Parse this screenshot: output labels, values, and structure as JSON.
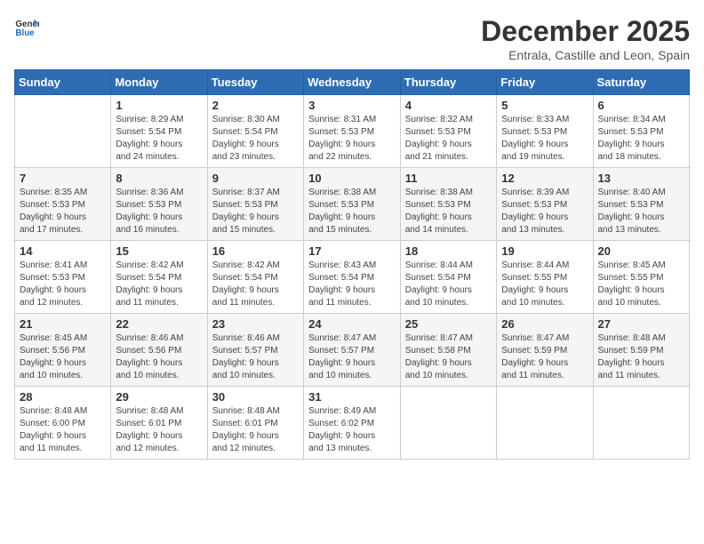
{
  "logo": {
    "general": "General",
    "blue": "Blue"
  },
  "title": "December 2025",
  "subtitle": "Entrala, Castille and Leon, Spain",
  "weekdays": [
    "Sunday",
    "Monday",
    "Tuesday",
    "Wednesday",
    "Thursday",
    "Friday",
    "Saturday"
  ],
  "weeks": [
    [
      {
        "day": "",
        "info": ""
      },
      {
        "day": "1",
        "info": "Sunrise: 8:29 AM\nSunset: 5:54 PM\nDaylight: 9 hours\nand 24 minutes."
      },
      {
        "day": "2",
        "info": "Sunrise: 8:30 AM\nSunset: 5:54 PM\nDaylight: 9 hours\nand 23 minutes."
      },
      {
        "day": "3",
        "info": "Sunrise: 8:31 AM\nSunset: 5:53 PM\nDaylight: 9 hours\nand 22 minutes."
      },
      {
        "day": "4",
        "info": "Sunrise: 8:32 AM\nSunset: 5:53 PM\nDaylight: 9 hours\nand 21 minutes."
      },
      {
        "day": "5",
        "info": "Sunrise: 8:33 AM\nSunset: 5:53 PM\nDaylight: 9 hours\nand 19 minutes."
      },
      {
        "day": "6",
        "info": "Sunrise: 8:34 AM\nSunset: 5:53 PM\nDaylight: 9 hours\nand 18 minutes."
      }
    ],
    [
      {
        "day": "7",
        "info": "Sunrise: 8:35 AM\nSunset: 5:53 PM\nDaylight: 9 hours\nand 17 minutes."
      },
      {
        "day": "8",
        "info": "Sunrise: 8:36 AM\nSunset: 5:53 PM\nDaylight: 9 hours\nand 16 minutes."
      },
      {
        "day": "9",
        "info": "Sunrise: 8:37 AM\nSunset: 5:53 PM\nDaylight: 9 hours\nand 15 minutes."
      },
      {
        "day": "10",
        "info": "Sunrise: 8:38 AM\nSunset: 5:53 PM\nDaylight: 9 hours\nand 15 minutes."
      },
      {
        "day": "11",
        "info": "Sunrise: 8:38 AM\nSunset: 5:53 PM\nDaylight: 9 hours\nand 14 minutes."
      },
      {
        "day": "12",
        "info": "Sunrise: 8:39 AM\nSunset: 5:53 PM\nDaylight: 9 hours\nand 13 minutes."
      },
      {
        "day": "13",
        "info": "Sunrise: 8:40 AM\nSunset: 5:53 PM\nDaylight: 9 hours\nand 13 minutes."
      }
    ],
    [
      {
        "day": "14",
        "info": "Sunrise: 8:41 AM\nSunset: 5:53 PM\nDaylight: 9 hours\nand 12 minutes."
      },
      {
        "day": "15",
        "info": "Sunrise: 8:42 AM\nSunset: 5:54 PM\nDaylight: 9 hours\nand 11 minutes."
      },
      {
        "day": "16",
        "info": "Sunrise: 8:42 AM\nSunset: 5:54 PM\nDaylight: 9 hours\nand 11 minutes."
      },
      {
        "day": "17",
        "info": "Sunrise: 8:43 AM\nSunset: 5:54 PM\nDaylight: 9 hours\nand 11 minutes."
      },
      {
        "day": "18",
        "info": "Sunrise: 8:44 AM\nSunset: 5:54 PM\nDaylight: 9 hours\nand 10 minutes."
      },
      {
        "day": "19",
        "info": "Sunrise: 8:44 AM\nSunset: 5:55 PM\nDaylight: 9 hours\nand 10 minutes."
      },
      {
        "day": "20",
        "info": "Sunrise: 8:45 AM\nSunset: 5:55 PM\nDaylight: 9 hours\nand 10 minutes."
      }
    ],
    [
      {
        "day": "21",
        "info": "Sunrise: 8:45 AM\nSunset: 5:56 PM\nDaylight: 9 hours\nand 10 minutes."
      },
      {
        "day": "22",
        "info": "Sunrise: 8:46 AM\nSunset: 5:56 PM\nDaylight: 9 hours\nand 10 minutes."
      },
      {
        "day": "23",
        "info": "Sunrise: 8:46 AM\nSunset: 5:57 PM\nDaylight: 9 hours\nand 10 minutes."
      },
      {
        "day": "24",
        "info": "Sunrise: 8:47 AM\nSunset: 5:57 PM\nDaylight: 9 hours\nand 10 minutes."
      },
      {
        "day": "25",
        "info": "Sunrise: 8:47 AM\nSunset: 5:58 PM\nDaylight: 9 hours\nand 10 minutes."
      },
      {
        "day": "26",
        "info": "Sunrise: 8:47 AM\nSunset: 5:59 PM\nDaylight: 9 hours\nand 11 minutes."
      },
      {
        "day": "27",
        "info": "Sunrise: 8:48 AM\nSunset: 5:59 PM\nDaylight: 9 hours\nand 11 minutes."
      }
    ],
    [
      {
        "day": "28",
        "info": "Sunrise: 8:48 AM\nSunset: 6:00 PM\nDaylight: 9 hours\nand 11 minutes."
      },
      {
        "day": "29",
        "info": "Sunrise: 8:48 AM\nSunset: 6:01 PM\nDaylight: 9 hours\nand 12 minutes."
      },
      {
        "day": "30",
        "info": "Sunrise: 8:48 AM\nSunset: 6:01 PM\nDaylight: 9 hours\nand 12 minutes."
      },
      {
        "day": "31",
        "info": "Sunrise: 8:49 AM\nSunset: 6:02 PM\nDaylight: 9 hours\nand 13 minutes."
      },
      {
        "day": "",
        "info": ""
      },
      {
        "day": "",
        "info": ""
      },
      {
        "day": "",
        "info": ""
      }
    ]
  ]
}
